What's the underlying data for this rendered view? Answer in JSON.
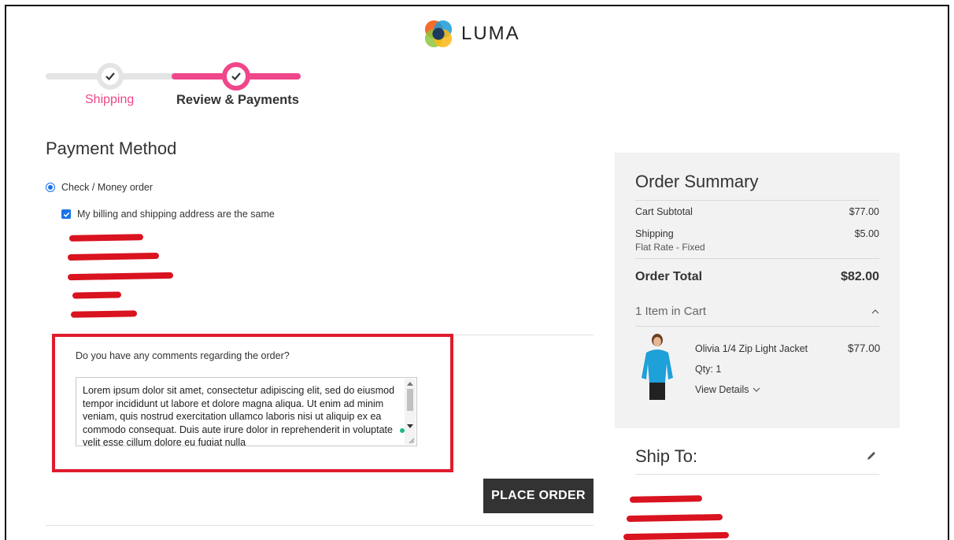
{
  "brand": {
    "name": "LUMA"
  },
  "progress": {
    "steps": [
      {
        "label": "Shipping",
        "state": "complete"
      },
      {
        "label": "Review & Payments",
        "state": "active"
      }
    ]
  },
  "payment": {
    "title": "Payment Method",
    "method_label": "Check / Money order",
    "same_address_label": "My billing and shipping address are the same"
  },
  "comments": {
    "label": "Do you have any comments regarding the order?",
    "value": "Lorem ipsum dolor sit amet, consectetur adipiscing elit, sed do eiusmod tempor incididunt ut labore et dolore magna aliqua. Ut enim ad minim veniam, quis nostrud exercitation ullamco laboris nisi ut aliquip ex ea commodo consequat. Duis aute irure dolor in reprehenderit in voluptate velit esse cillum dolore eu fugiat nulla"
  },
  "actions": {
    "place_order": "PLACE ORDER"
  },
  "summary": {
    "title": "Order Summary",
    "cart_subtotal_label": "Cart Subtotal",
    "cart_subtotal_value": "$77.00",
    "shipping_label": "Shipping",
    "shipping_method": "Flat Rate - Fixed",
    "shipping_value": "$5.00",
    "total_label": "Order Total",
    "total_value": "$82.00",
    "items_label": "1 Item in Cart",
    "item": {
      "name": "Olivia 1/4 Zip Light Jacket",
      "price": "$77.00",
      "qty": "Qty: 1",
      "details_label": "View Details"
    }
  },
  "ship_to": {
    "title": "Ship To:"
  },
  "colors": {
    "accent": "#f0468a",
    "highlight": "#e01b2d",
    "button": "#333333"
  }
}
